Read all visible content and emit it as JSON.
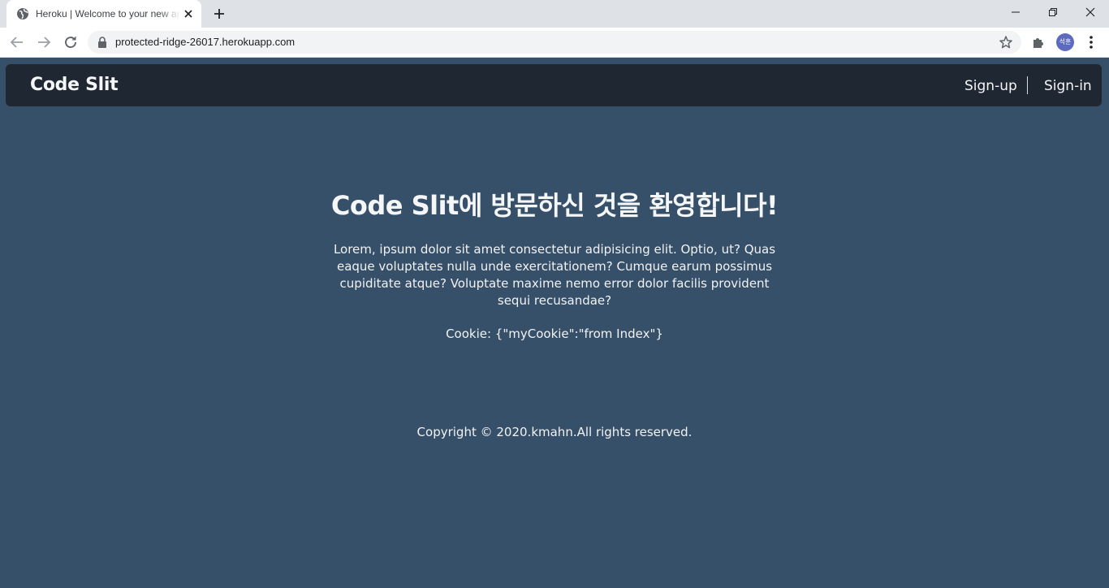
{
  "browser": {
    "tab": {
      "title": "Heroku | Welcome to your new app!"
    },
    "address_bar": {
      "url": "protected-ridge-26017.herokuapp.com"
    },
    "profile": {
      "avatar_text": "석훈",
      "avatar_color": "#5c6bc0"
    },
    "icons": [
      "globe-icon",
      "close-icon",
      "plus-icon",
      "minimize-icon",
      "restore-icon",
      "close-window-icon",
      "back-arrow-icon",
      "forward-arrow-icon",
      "reload-icon",
      "lock-icon",
      "star-icon",
      "puzzle-icon",
      "kebab-menu-icon"
    ]
  },
  "navbar": {
    "brand": "Code Slit",
    "links": [
      {
        "label": "Sign-up"
      },
      {
        "label": "Sign-in"
      }
    ],
    "background": "#1f2733"
  },
  "hero": {
    "title": "Code Slit에 방문하신 것을 환영합니다!",
    "description": "Lorem, ipsum dolor sit amet consectetur adipisicing elit. Optio, ut? Quas eaque voluptates nulla unde exercitationem? Cumque earum possimus cupiditate atque? Voluptate maxime nemo error dolor facilis provident sequi recusandae?",
    "cookie": "Cookie: {\"myCookie\":\"from Index\"}"
  },
  "footer": {
    "copyright": "Copyright © 2020.kmahn.All rights reserved."
  },
  "colors": {
    "page_background": "#375069",
    "text": "#f5f6f7"
  }
}
